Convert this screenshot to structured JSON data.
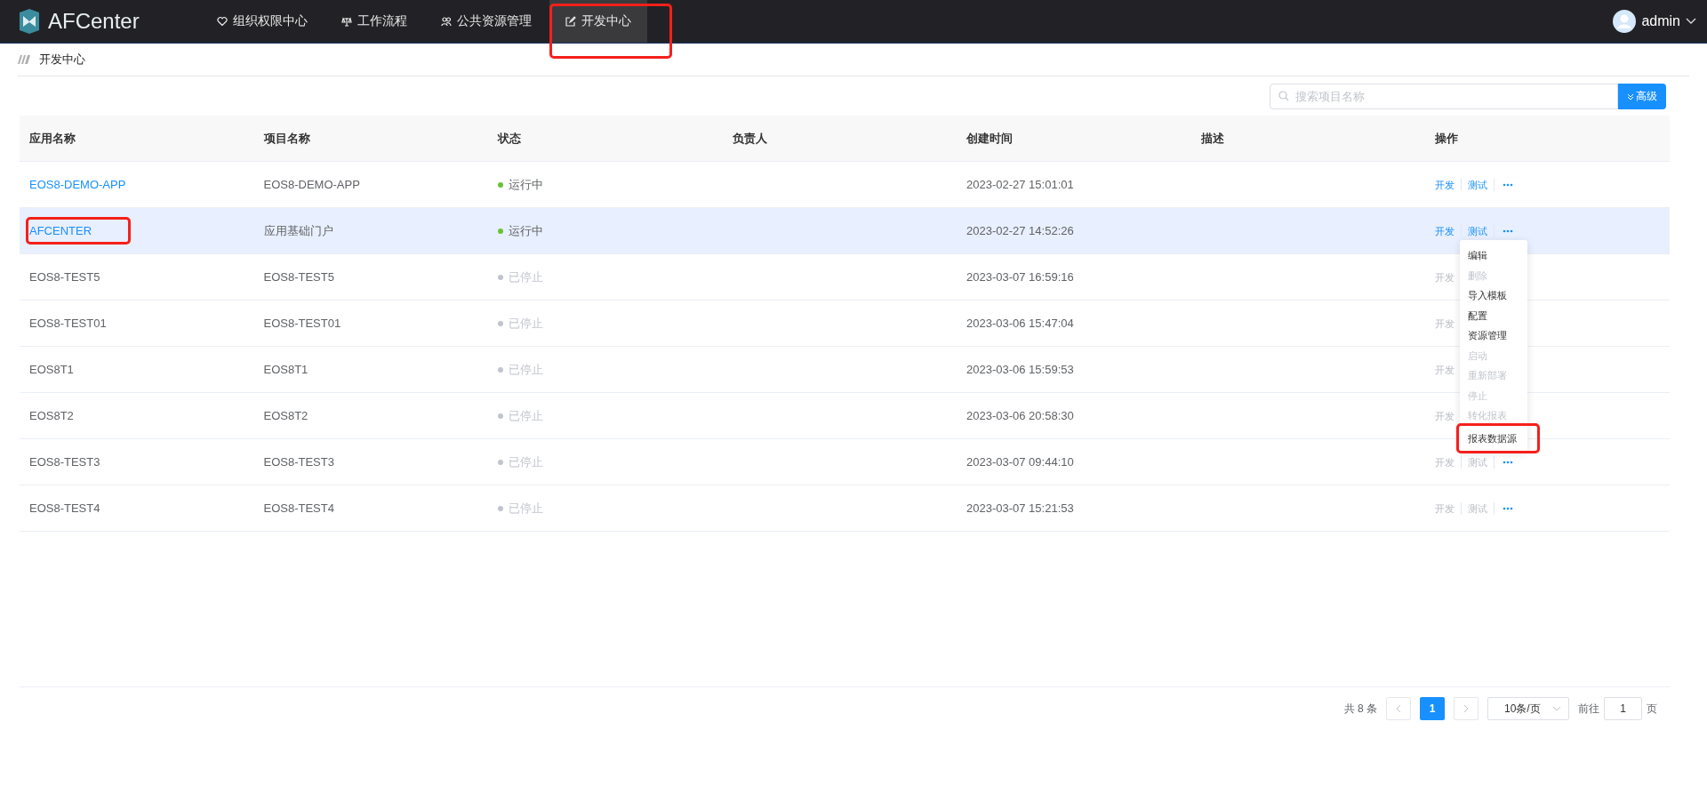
{
  "header": {
    "logo": "AFCenter",
    "nav": [
      {
        "label": "组织权限中心",
        "selected": false,
        "marked": false
      },
      {
        "label": "工作流程",
        "selected": false,
        "marked": false
      },
      {
        "label": "公共资源管理",
        "selected": false,
        "marked": false
      },
      {
        "label": "开发中心",
        "selected": true,
        "marked": true
      }
    ],
    "user": "admin"
  },
  "breadcrumb": "开发中心",
  "search": {
    "placeholder": "搜索项目名称",
    "advanced": "高级"
  },
  "table": {
    "columns": [
      "应用名称",
      "项目名称",
      "状态",
      "负责人",
      "创建时间",
      "描述",
      "操作"
    ],
    "rows": [
      {
        "app": "EOS8-DEMO-APP",
        "link": true,
        "marked": false,
        "selected": false,
        "project": "EOS8-DEMO-APP",
        "status": "运行中",
        "running": true,
        "created": "2023-02-27 15:01:01",
        "actions": [
          {
            "kind": "link",
            "label": "开发",
            "enabled": true
          },
          {
            "kind": "link",
            "label": "测试",
            "enabled": true
          },
          {
            "kind": "more",
            "enabled": true
          }
        ]
      },
      {
        "app": "AFCENTER",
        "link": true,
        "marked": true,
        "selected": true,
        "project": "应用基础门户",
        "status": "运行中",
        "running": true,
        "created": "2023-02-27 14:52:26",
        "actions": [
          {
            "kind": "link",
            "label": "开发",
            "enabled": true
          },
          {
            "kind": "link",
            "label": "测试",
            "enabled": true
          },
          {
            "kind": "more",
            "enabled": true
          }
        ]
      },
      {
        "app": "EOS8-TEST5",
        "link": false,
        "marked": false,
        "selected": false,
        "project": "EOS8-TEST5",
        "status": "已停止",
        "running": false,
        "created": "2023-03-07 16:59:16",
        "actions": [
          {
            "kind": "link",
            "label": "开发",
            "enabled": false
          }
        ]
      },
      {
        "app": "EOS8-TEST01",
        "link": false,
        "marked": false,
        "selected": false,
        "project": "EOS8-TEST01",
        "status": "已停止",
        "running": false,
        "created": "2023-03-06 15:47:04",
        "actions": [
          {
            "kind": "link",
            "label": "开发",
            "enabled": false
          }
        ]
      },
      {
        "app": "EOS8T1",
        "link": false,
        "marked": false,
        "selected": false,
        "project": "EOS8T1",
        "status": "已停止",
        "running": false,
        "created": "2023-03-06 15:59:53",
        "actions": [
          {
            "kind": "link",
            "label": "开发",
            "enabled": false
          }
        ]
      },
      {
        "app": "EOS8T2",
        "link": false,
        "marked": false,
        "selected": false,
        "project": "EOS8T2",
        "status": "已停止",
        "running": false,
        "created": "2023-03-06 20:58:30",
        "actions": [
          {
            "kind": "link",
            "label": "开发",
            "enabled": false
          }
        ]
      },
      {
        "app": "EOS8-TEST3",
        "link": false,
        "marked": false,
        "selected": false,
        "project": "EOS8-TEST3",
        "status": "已停止",
        "running": false,
        "created": "2023-03-07 09:44:10",
        "actions": [
          {
            "kind": "link",
            "label": "开发",
            "enabled": false
          },
          {
            "kind": "link",
            "label": "测试",
            "enabled": false
          },
          {
            "kind": "more",
            "enabled": true
          }
        ]
      },
      {
        "app": "EOS8-TEST4",
        "link": false,
        "marked": false,
        "selected": false,
        "project": "EOS8-TEST4",
        "status": "已停止",
        "running": false,
        "created": "2023-03-07 15:21:53",
        "actions": [
          {
            "kind": "link",
            "label": "开发",
            "enabled": false
          },
          {
            "kind": "link",
            "label": "测试",
            "enabled": false
          },
          {
            "kind": "more",
            "enabled": true
          }
        ]
      }
    ]
  },
  "menu": [
    {
      "label": "编辑",
      "enabled": true,
      "marked": false
    },
    {
      "label": "删除",
      "enabled": false,
      "marked": false
    },
    {
      "label": "导入模板",
      "enabled": true,
      "marked": false
    },
    {
      "label": "配置",
      "enabled": true,
      "marked": false
    },
    {
      "label": "资源管理",
      "enabled": true,
      "marked": false
    },
    {
      "label": "启动",
      "enabled": false,
      "marked": false
    },
    {
      "label": "重新部署",
      "enabled": false,
      "marked": false
    },
    {
      "label": "停止",
      "enabled": false,
      "marked": false
    },
    {
      "label": "转化报表",
      "enabled": false,
      "marked": false
    },
    {
      "label": "报表数据源",
      "enabled": true,
      "marked": true
    }
  ],
  "pagination": {
    "total": "共 8 条",
    "pages": [
      {
        "label": "1",
        "selected": true
      }
    ],
    "page_size": "10条/页",
    "goto": "前往",
    "goto_value": "1",
    "page_unit": "页"
  }
}
